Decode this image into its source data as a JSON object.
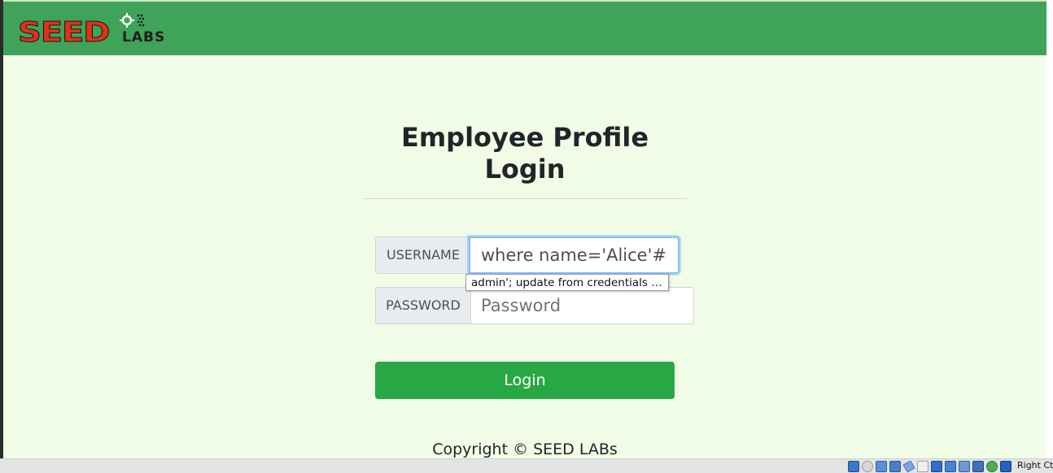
{
  "brand": {
    "logo_main": "SEED",
    "logo_sub": "LABS"
  },
  "page": {
    "title": "Employee Profile Login"
  },
  "form": {
    "username": {
      "label": "USERNAME",
      "value": " where name='Alice'#"
    },
    "password": {
      "label": "PASSWORD",
      "placeholder": "Password"
    },
    "autocomplete_suggestion": "admin'; update from credentials …",
    "submit_label": "Login"
  },
  "footer": {
    "copyright": "Copyright © SEED LABs"
  },
  "host_bar": {
    "right_label": "Right Ctrl",
    "icons": [
      "hard-disk-icon",
      "optical-drive-icon",
      "audio-icon",
      "network-icon",
      "usb-icon",
      "shared-folder-icon",
      "display-icon",
      "screen-capture-icon",
      "video-capture-icon",
      "cpu-icon",
      "guest-additions-icon",
      "arrow-down-icon"
    ]
  },
  "colors": {
    "header": "#3fa35a",
    "background": "#f1fce6",
    "button": "#28a745",
    "focus": "#80bdff"
  }
}
